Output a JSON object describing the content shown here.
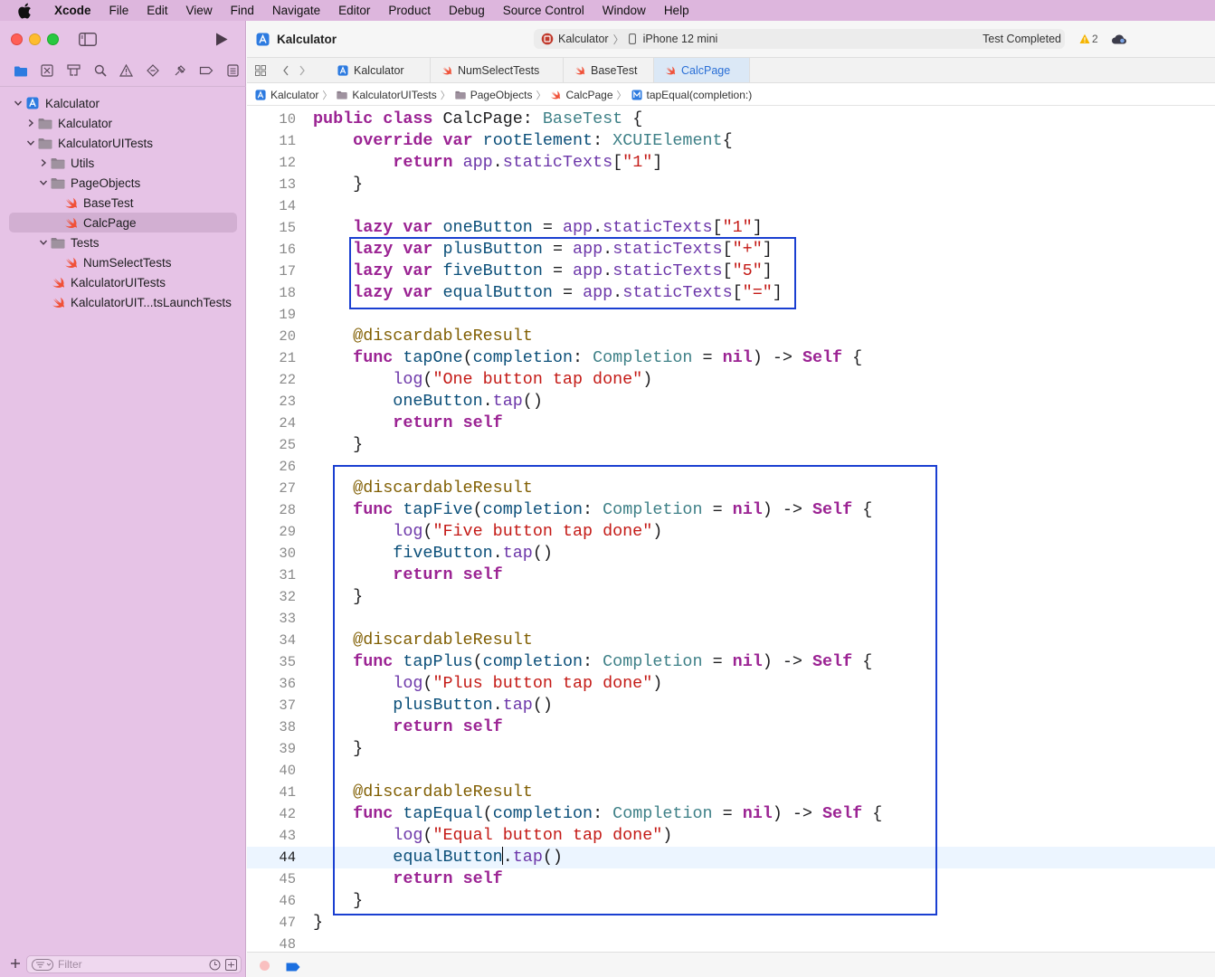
{
  "menubar": {
    "app": "Xcode",
    "items": [
      "File",
      "Edit",
      "View",
      "Find",
      "Navigate",
      "Editor",
      "Product",
      "Debug",
      "Source Control",
      "Window",
      "Help"
    ]
  },
  "toolbar": {
    "project": "Kalculator",
    "scheme": "Kalculator",
    "separator": "〉",
    "device": "iPhone 12 mini",
    "status": "Test Completed",
    "warning_count": "2"
  },
  "navigator": {
    "tree": [
      {
        "label": "Kalculator",
        "kind": "project",
        "indent": 0,
        "disclosure": "open"
      },
      {
        "label": "Kalculator",
        "kind": "folder",
        "indent": 1,
        "disclosure": "closed"
      },
      {
        "label": "KalculatorUITests",
        "kind": "folder",
        "indent": 1,
        "disclosure": "open"
      },
      {
        "label": "Utils",
        "kind": "folder",
        "indent": 2,
        "disclosure": "closed"
      },
      {
        "label": "PageObjects",
        "kind": "folder",
        "indent": 2,
        "disclosure": "open"
      },
      {
        "label": "BaseTest",
        "kind": "swift",
        "indent": 3,
        "disclosure": "none"
      },
      {
        "label": "CalcPage",
        "kind": "swift",
        "indent": 3,
        "disclosure": "none",
        "selected": true
      },
      {
        "label": "Tests",
        "kind": "folder",
        "indent": 2,
        "disclosure": "open"
      },
      {
        "label": "NumSelectTests",
        "kind": "swift",
        "indent": 3,
        "disclosure": "none"
      },
      {
        "label": "KalculatorUITests",
        "kind": "swift",
        "indent": 2,
        "disclosure": "none"
      },
      {
        "label": "KalculatorUIT...tsLaunchTests",
        "kind": "swift",
        "indent": 2,
        "disclosure": "none"
      }
    ],
    "filter_placeholder": "Filter"
  },
  "tabs": [
    {
      "label": "Kalculator",
      "kind": "project",
      "active": false
    },
    {
      "label": "NumSelectTests",
      "kind": "swift",
      "active": false
    },
    {
      "label": "BaseTest",
      "kind": "swift",
      "active": false
    },
    {
      "label": "CalcPage",
      "kind": "swift",
      "active": true
    }
  ],
  "breadcrumb": [
    {
      "label": "Kalculator",
      "kind": "project"
    },
    {
      "label": "KalculatorUITests",
      "kind": "folder"
    },
    {
      "label": "PageObjects",
      "kind": "folder"
    },
    {
      "label": "CalcPage",
      "kind": "swift"
    },
    {
      "label": "tapEqual(completion:)",
      "kind": "method"
    }
  ],
  "breadcrumb_separator": "〉",
  "editor": {
    "first_line": 10,
    "current_line": 44,
    "lines": [
      "public class CalcPage: BaseTest {",
      "    override var rootElement: XCUIElement{",
      "        return app.staticTexts[\"1\"]",
      "    }",
      "",
      "    lazy var oneButton = app.staticTexts[\"1\"]",
      "    lazy var plusButton = app.staticTexts[\"+\"]",
      "    lazy var fiveButton = app.staticTexts[\"5\"]",
      "    lazy var equalButton = app.staticTexts[\"=\"]",
      "",
      "    @discardableResult",
      "    func tapOne(completion: Completion = nil) -> Self {",
      "        log(\"One button tap done\")",
      "        oneButton.tap()",
      "        return self",
      "    }",
      "",
      "    @discardableResult",
      "    func tapFive(completion: Completion = nil) -> Self {",
      "        log(\"Five button tap done\")",
      "        fiveButton.tap()",
      "        return self",
      "    }",
      "",
      "    @discardableResult",
      "    func tapPlus(completion: Completion = nil) -> Self {",
      "        log(\"Plus button tap done\")",
      "        plusButton.tap()",
      "        return self",
      "    }",
      "",
      "    @discardableResult",
      "    func tapEqual(completion: Completion = nil) -> Self {",
      "        log(\"Equal button tap done\")",
      "        equalButton.tap()",
      "        return self",
      "    }",
      "}",
      ""
    ]
  },
  "colors": {
    "menubar": "#ddb6dd",
    "sidebar": "#e6c3e6",
    "selection": "#d2afd2",
    "highlight_box": "#1a3fd1",
    "keyword": "#9b2393",
    "string": "#c41a16",
    "accent": "#2a6fd6"
  }
}
